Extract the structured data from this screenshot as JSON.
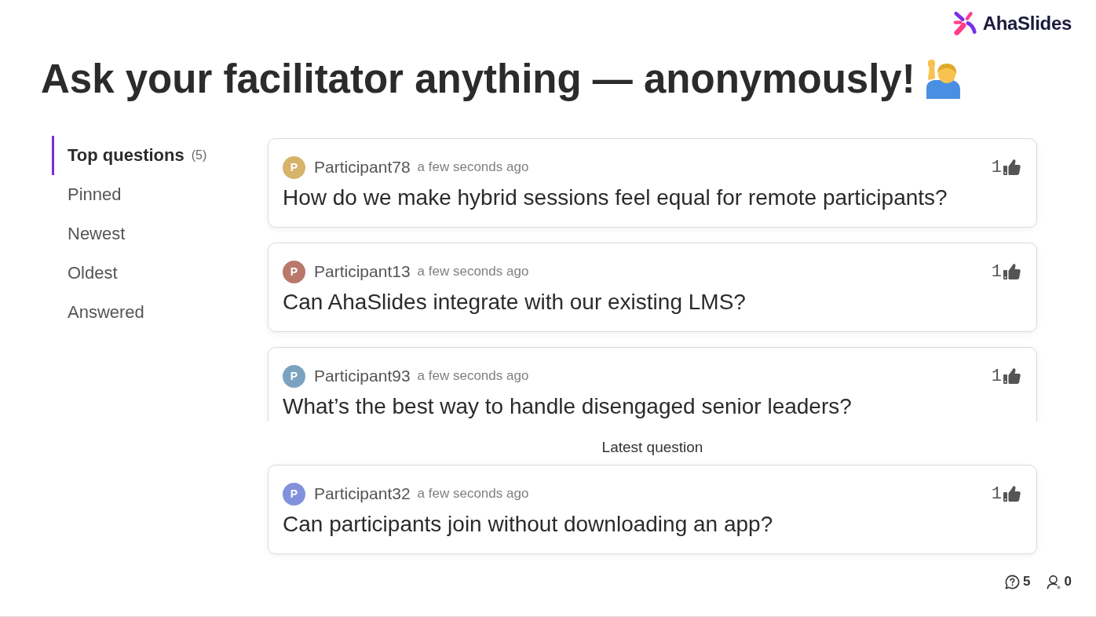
{
  "logo": {
    "text": "AhaSlides"
  },
  "title": "Ask your facilitator anything — anonymously!",
  "sidebar": {
    "items": [
      {
        "label": "Top questions",
        "count": "(5)",
        "selected": true
      },
      {
        "label": "Pinned",
        "selected": false
      },
      {
        "label": "Newest",
        "selected": false
      },
      {
        "label": "Oldest",
        "selected": false
      },
      {
        "label": "Answered",
        "selected": false
      }
    ]
  },
  "questions": [
    {
      "avatar_letter": "P",
      "color": "#d6b36a",
      "author": "Participant78",
      "time": "a few seconds ago",
      "text": "How do we make hybrid sessions feel equal for remote participants?",
      "votes": "1"
    },
    {
      "avatar_letter": "P",
      "color": "#b9786a",
      "author": "Participant13",
      "time": "a few seconds ago",
      "text": "Can AhaSlides integrate with our existing LMS?",
      "votes": "1"
    },
    {
      "avatar_letter": "P",
      "color": "#7ba3c1",
      "author": "Participant93",
      "time": "a few seconds ago",
      "text": "What’s the best way to handle disengaged senior leaders?",
      "votes": "1"
    }
  ],
  "latest": {
    "label": "Latest question",
    "question": {
      "avatar_letter": "P",
      "color": "#8291db",
      "author": "Participant32",
      "time": "a few seconds ago",
      "text": "Can participants join without downloading an app?",
      "votes": "1"
    }
  },
  "footer": {
    "questions_count": "5",
    "participants_count": "0"
  }
}
